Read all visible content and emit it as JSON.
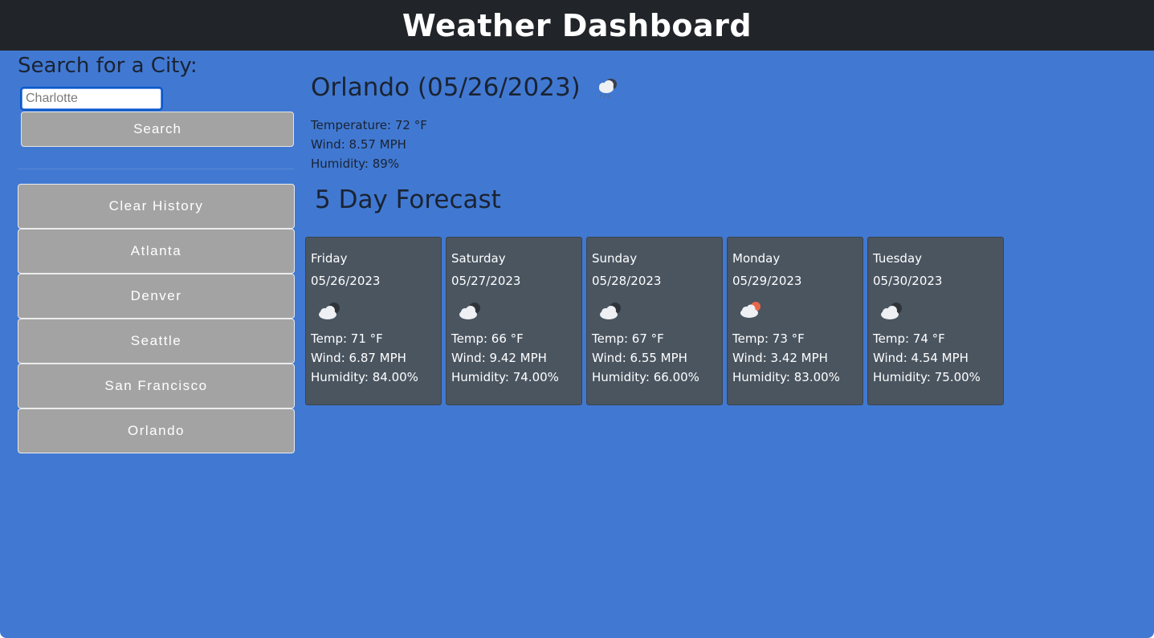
{
  "header": {
    "title": "Weather Dashboard"
  },
  "search": {
    "title": "Search for a City:",
    "placeholder": "Charlotte",
    "value": "",
    "button_label": "Search"
  },
  "history": {
    "clear_label": "Clear History",
    "cities": [
      "Atlanta",
      "Denver",
      "Seattle",
      "San Francisco",
      "Orlando"
    ]
  },
  "current": {
    "title": "Orlando (05/26/2023)",
    "icon": "rain-cloud-night-icon",
    "temperature": "Temperature: 72 °F",
    "wind": "Wind: 8.57 MPH",
    "humidity": "Humidity: 89%"
  },
  "forecast": {
    "title": "5 Day Forecast",
    "days": [
      {
        "day": "Friday",
        "date": "05/26/2023",
        "icon": "cloud-night-icon",
        "temp": "Temp: 71 °F",
        "wind": "Wind: 6.87 MPH",
        "humidity": "Humidity: 84.00%"
      },
      {
        "day": "Saturday",
        "date": "05/27/2023",
        "icon": "cloud-night-icon",
        "temp": "Temp: 66 °F",
        "wind": "Wind: 9.42 MPH",
        "humidity": "Humidity: 74.00%"
      },
      {
        "day": "Sunday",
        "date": "05/28/2023",
        "icon": "cloud-night-icon",
        "temp": "Temp: 67 °F",
        "wind": "Wind: 6.55 MPH",
        "humidity": "Humidity: 66.00%"
      },
      {
        "day": "Monday",
        "date": "05/29/2023",
        "icon": "cloud-sun-icon",
        "temp": "Temp: 73 °F",
        "wind": "Wind: 3.42 MPH",
        "humidity": "Humidity: 83.00%"
      },
      {
        "day": "Tuesday",
        "date": "05/30/2023",
        "icon": "cloud-night-icon",
        "temp": "Temp: 74 °F",
        "wind": "Wind: 4.54 MPH",
        "humidity": "Humidity: 75.00%"
      }
    ]
  },
  "colors": {
    "header_bg": "#212529",
    "page_bg": "#4179d2",
    "button_bg": "#a3a3a3",
    "card_bg": "#4a5560"
  }
}
